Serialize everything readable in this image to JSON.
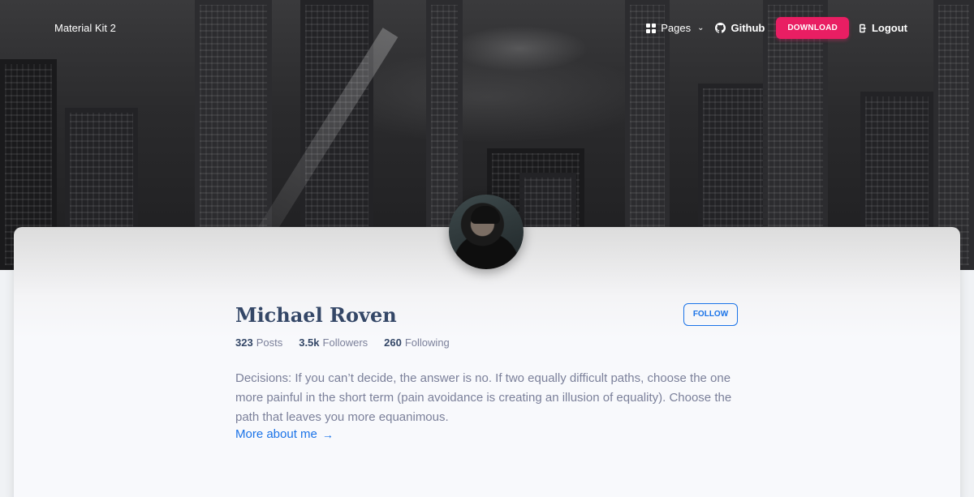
{
  "navbar": {
    "brand": "Material Kit 2",
    "pages_label": "Pages",
    "github_label": "Github",
    "download_label": "DOWNLOAD",
    "logout_label": "Logout",
    "accent_color": "#e91e63"
  },
  "profile": {
    "name": "Michael Roven",
    "follow_label": "FOLLOW",
    "stats": [
      {
        "value": "323",
        "label": "Posts"
      },
      {
        "value": "3.5k",
        "label": "Followers"
      },
      {
        "value": "260",
        "label": "Following"
      }
    ],
    "bio": "Decisions: If you can’t decide, the answer is no. If two equally difficult paths, choose the one more painful in the short term (pain avoidance is creating an illusion of equality). Choose the path that leaves you more equanimous.",
    "more_link": "More about me",
    "link_color": "#1a73e8"
  },
  "icons": {
    "pages": "grid-icon",
    "pages_dropdown": "chevron-down-icon",
    "github": "github-icon",
    "logout": "logout-icon",
    "more_link": "arrow-right-icon"
  }
}
